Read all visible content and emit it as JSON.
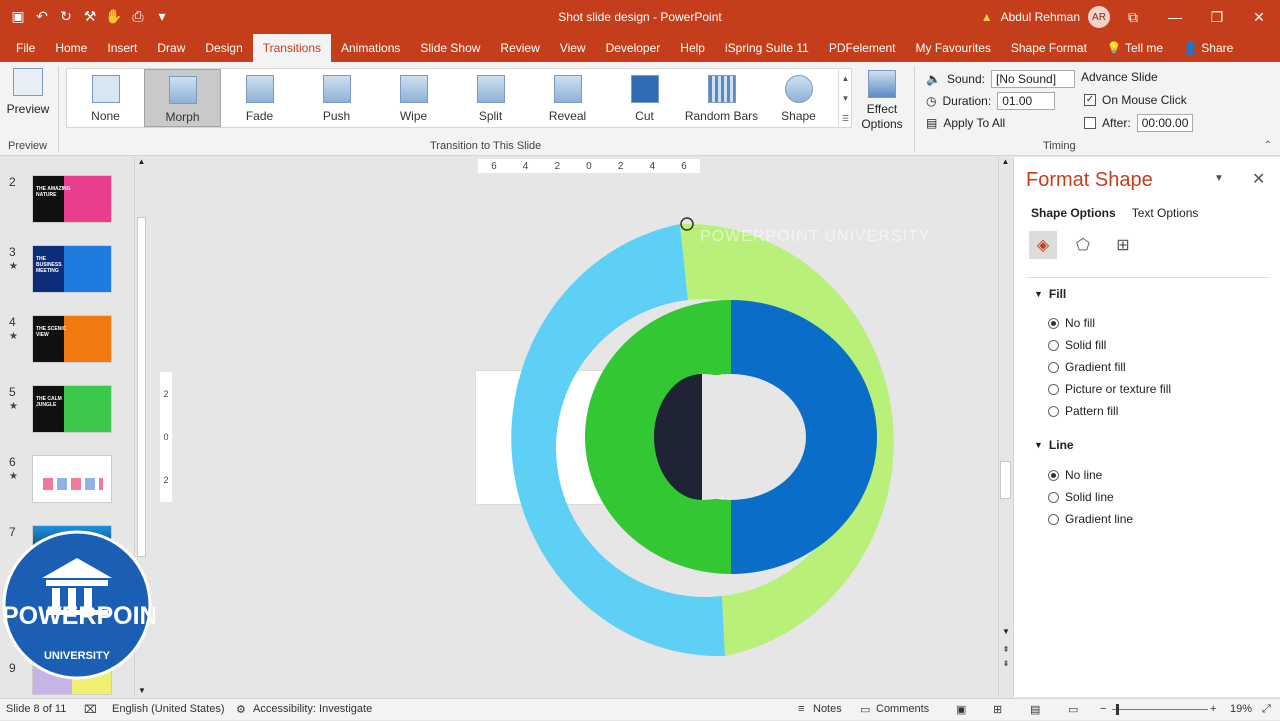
{
  "app": {
    "doc_title": "Shot slide design  -  PowerPoint",
    "user_name": "Abdul Rehman",
    "user_initials": "AR"
  },
  "tabs": [
    "File",
    "Home",
    "Insert",
    "Draw",
    "Design",
    "Transitions",
    "Animations",
    "Slide Show",
    "Review",
    "View",
    "Developer",
    "Help",
    "iSpring Suite 11",
    "PDFelement",
    "My Favourites",
    "Shape Format",
    "Tell me",
    "Share"
  ],
  "ribbon": {
    "preview_label": "Preview",
    "preview_group": "Preview",
    "transitions": [
      "None",
      "Morph",
      "Fade",
      "Push",
      "Wipe",
      "Split",
      "Reveal",
      "Cut",
      "Random Bars",
      "Shape"
    ],
    "selected_transition": "Morph",
    "effect_options": "Effect Options",
    "group_transition": "Transition to This Slide",
    "sound_label": "Sound:",
    "sound_value": "[No Sound]",
    "duration_label": "Duration:",
    "duration_value": "01.00",
    "apply_all": "Apply To All",
    "advance_slide": "Advance Slide",
    "on_mouse_click": "On Mouse Click",
    "after_label": "After:",
    "after_value": "00:00.00",
    "group_timing": "Timing"
  },
  "thumbnails": [
    {
      "num": "2",
      "star": "",
      "text": "THE AMAZING NATURE",
      "bg": "#e83e8c",
      "accent": "#2a2a2a"
    },
    {
      "num": "3",
      "star": "★",
      "text": "THE BUSINESS MEETING",
      "bg": "#1e7be0",
      "accent": "#0b2d7a"
    },
    {
      "num": "4",
      "star": "★",
      "text": "THE SCENIC VIEW",
      "bg": "#f07a10",
      "accent": "#1a1a1a"
    },
    {
      "num": "5",
      "star": "★",
      "text": "THE CALM JUNGLE",
      "bg": "#3cc84a",
      "accent": "#111"
    },
    {
      "num": "6",
      "star": "★",
      "text": "",
      "bg": "#ffffff",
      "accent": "#cccccc"
    },
    {
      "num": "7",
      "star": "",
      "text": "",
      "bg": "#1e90e0",
      "accent": "#0a0a0a"
    },
    {
      "num": "9",
      "star": "",
      "text": "",
      "bg": "#c8b3e8",
      "accent": "#f0f070"
    }
  ],
  "logo": {
    "line1": "POWERPOINT",
    "line2": "UNIVERSITY"
  },
  "canvas": {
    "watermark": "POWERPOINT UNIVERSITY",
    "ruler_h": [
      "6",
      "4",
      "2",
      "0",
      "2",
      "4",
      "6"
    ],
    "ruler_v": [
      "2",
      "0",
      "2"
    ]
  },
  "pane": {
    "title": "Format Shape",
    "tab_shape": "Shape Options",
    "tab_text": "Text Options",
    "fill_section": "Fill",
    "fill_options": [
      "No fill",
      "Solid fill",
      "Gradient fill",
      "Picture or texture fill",
      "Pattern fill"
    ],
    "line_section": "Line",
    "line_options": [
      "No line",
      "Solid line",
      "Gradient line"
    ]
  },
  "status": {
    "slide": "Slide 8 of 11",
    "language": "English (United States)",
    "accessibility": "Accessibility: Investigate",
    "notes": "Notes",
    "comments": "Comments",
    "zoom": "19%"
  },
  "colors": {
    "accent": "#c43e1c",
    "ring_light_blue": "#5fd0f5",
    "ring_light_green": "#b8f07a",
    "ring_green": "#34c734",
    "ring_blue": "#0a6ec8",
    "inner_dark": "#1e2433"
  }
}
